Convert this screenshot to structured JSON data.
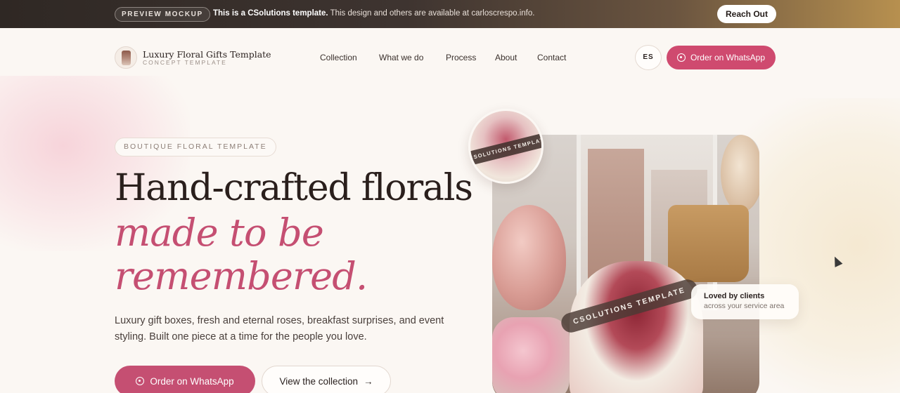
{
  "banner": {
    "tag": "PREVIEW MOCKUP",
    "message_bold": "This is a CSolutions template.",
    "message_rest": " This design and others are available at carloscrespo.info.",
    "button": "Reach Out"
  },
  "header": {
    "brand_name": "Luxury Floral Gifts Template",
    "brand_sub": "CONCEPT TEMPLATE",
    "nav": [
      "Collection",
      "What we do",
      "Process",
      "About",
      "Contact"
    ],
    "lang": "ES",
    "cta": "Order on WhatsApp"
  },
  "hero": {
    "eyebrow": "BOUTIQUE FLORAL TEMPLATE",
    "line1": "Hand-crafted florals",
    "line2": "made to be",
    "line3": "remembered.",
    "description": "Luxury gift boxes, fresh and eternal roses, breakfast surprises, and event styling. Built one piece at a time for the people you love.",
    "cta_primary": "Order on WhatsApp",
    "cta_secondary": "View the collection",
    "photo_stamp": "CSOLUTIONS TEMPLATE",
    "thumb_stamp": "CSOLUTIONS TEMPLATE",
    "loved_title": "Loved by clients",
    "loved_sub": "across your service area"
  },
  "colors": {
    "accent": "#cf4a6f",
    "accent_text": "#c54f72",
    "background": "#fbf7f3",
    "banner_dark": "#2f2824",
    "banner_gold": "#b7904f"
  },
  "icons": {
    "whatsapp": "whatsapp-icon",
    "arrow": "arrow-right-icon"
  }
}
